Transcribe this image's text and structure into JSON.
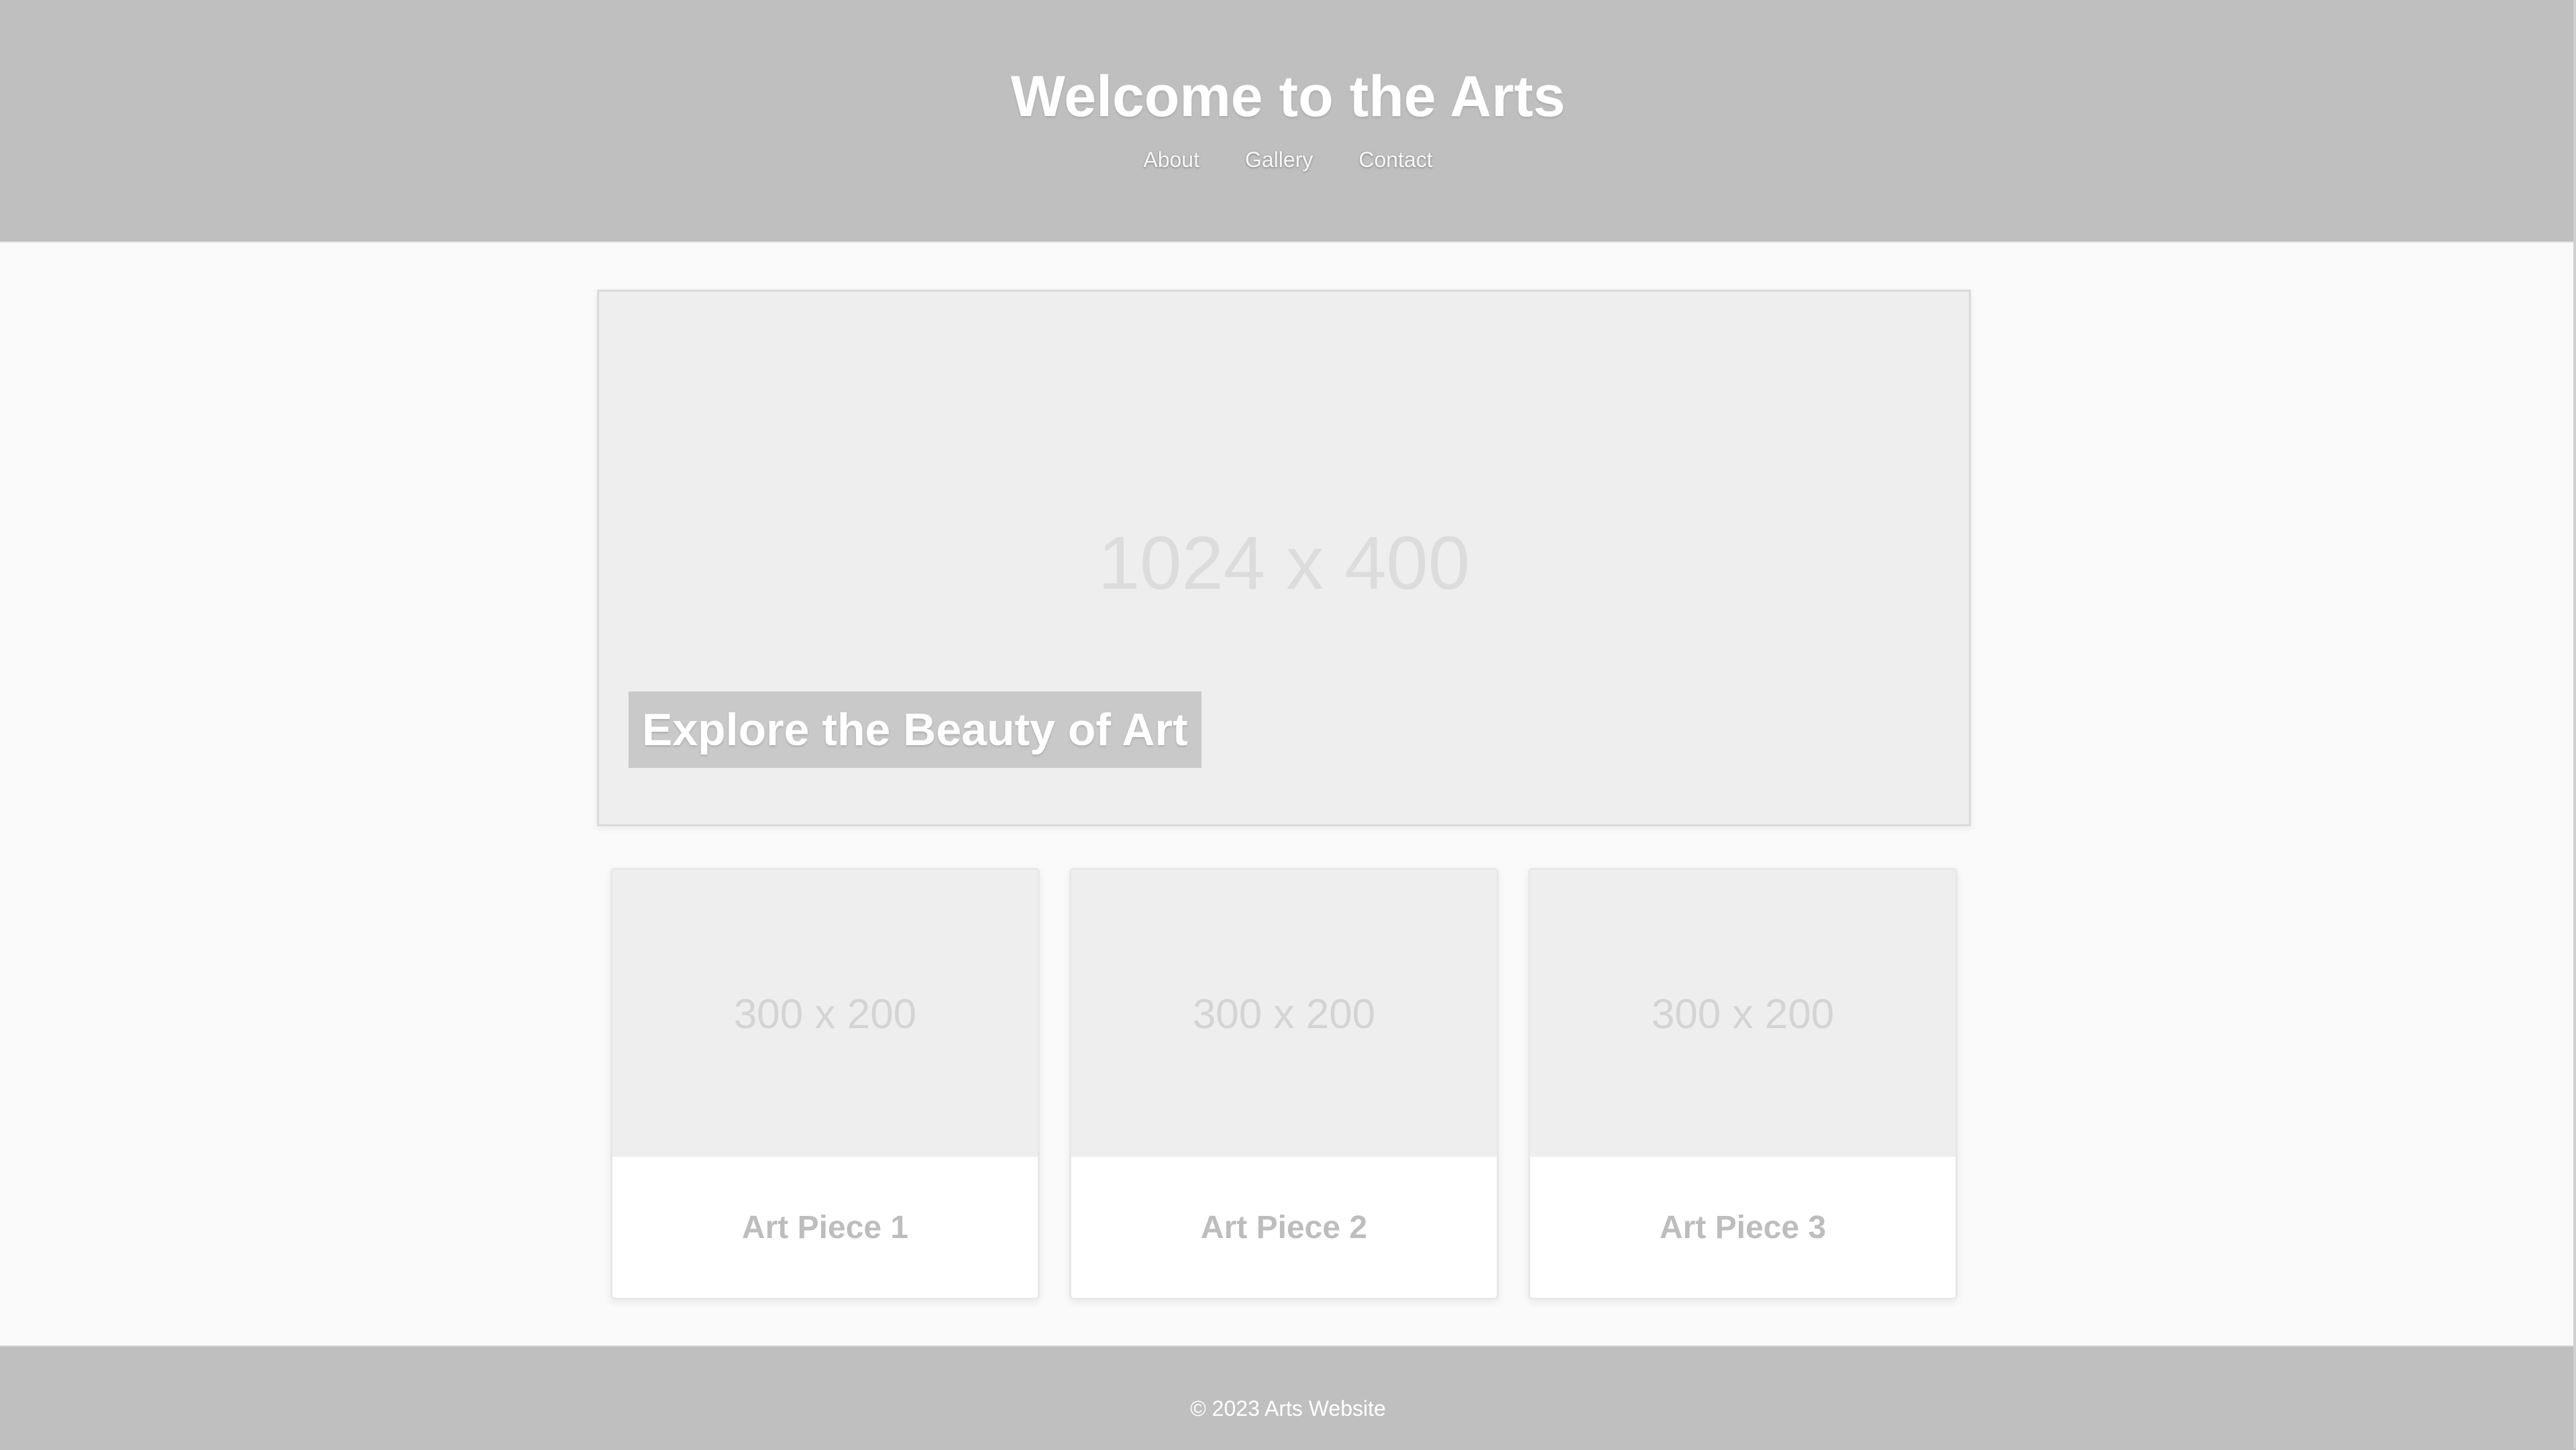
{
  "header": {
    "title": "Welcome to the Arts",
    "nav": [
      "About",
      "Gallery",
      "Contact"
    ]
  },
  "hero": {
    "placeholder": "1024 x 400",
    "caption": "Explore the Beauty of Art"
  },
  "gallery": {
    "cards": [
      {
        "image_label": "300 x 200",
        "title": "Art Piece 1"
      },
      {
        "image_label": "300 x 200",
        "title": "Art Piece 2"
      },
      {
        "image_label": "300 x 200",
        "title": "Art Piece 3"
      }
    ]
  },
  "footer": {
    "text": "© 2023 Arts Website"
  },
  "colors": {
    "header_background": "#bfbfbf",
    "page_background": "#fafafa",
    "placeholder_background": "#eeeeee",
    "card_title_text": "#bdbdbd"
  }
}
